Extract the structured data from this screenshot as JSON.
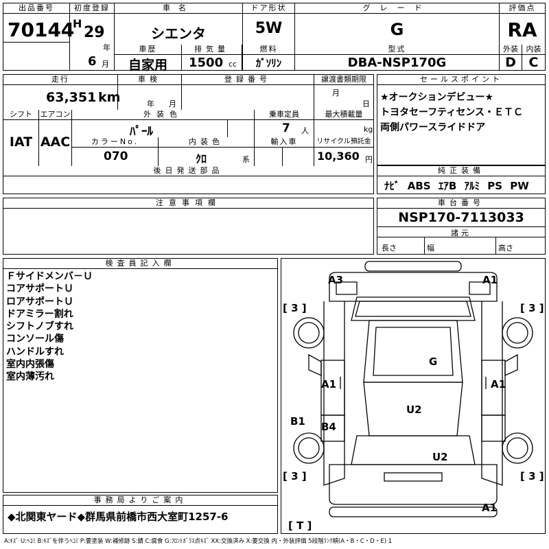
{
  "header": {
    "lot_number_label": "出品番号",
    "lot_number": "70144",
    "first_reg_label": "初度登録",
    "first_reg_era": "H",
    "first_reg_year": "29",
    "year_unit": "年",
    "first_reg_month": "6",
    "month_unit": "月",
    "car_name_label": "車名",
    "car_name": "シエンタ",
    "door_label": "ドア形状",
    "door": "5W",
    "grade_label": "グレード",
    "grade": "G",
    "score_label": "評価点",
    "score": "RA",
    "history_label": "車歴",
    "history": "自家用",
    "displacement_label": "排気量",
    "displacement": "1500",
    "displacement_unit": "cc",
    "fuel_label": "燃料",
    "fuel": "ｶﾞｿﾘﾝ",
    "model_label": "型式",
    "model": "DBA-NSP170G",
    "exterior_label": "外装",
    "exterior": "D",
    "interior_label": "内装",
    "interior": "C"
  },
  "mid": {
    "mileage_label": "走行",
    "mileage": "63,351",
    "mileage_unit": "km",
    "inspection_label": "車検",
    "inspection_year_unit": "年",
    "inspection_month_unit": "月",
    "registration_label": "登録番号",
    "transfer_label": "譲渡書類期限",
    "transfer_month_unit": "月",
    "transfer_day_unit": "日",
    "shift_label": "シフト",
    "shift": "IAT",
    "ac_label": "エアコン",
    "ac": "AAC",
    "color_label": "外装色",
    "color": "ﾊﾟｰﾙ",
    "capacity_label": "乗車定員",
    "capacity": "7",
    "capacity_unit": "人",
    "maxload_label": "最大積載量",
    "maxload_unit": "kg",
    "color_no_label": "カラーNo.",
    "color_no": "070",
    "int_color_label": "内装色",
    "int_color": "ｸﾛ",
    "int_color_unit": "系",
    "import_label": "輸入車",
    "recycle_label": "リサイクル預託金",
    "recycle": "10,360",
    "recycle_unit": "円",
    "later_parts_label": "後日発送部品"
  },
  "selling_points": {
    "label": "セールスポイント",
    "lines": [
      "★オークションデビュー★",
      "トヨタセーフティセンス・ＥＴＣ",
      "両側パワースライドドア"
    ]
  },
  "equipment": {
    "label": "純正装備",
    "items": [
      "ﾅﾋﾞ",
      "ABS",
      "ｴｱB",
      "ｱﾙﾐ",
      "PS",
      "PW"
    ]
  },
  "notes": {
    "label": "注意事項欄"
  },
  "chassis": {
    "label": "車台番号",
    "number": "NSP170-7113033",
    "specs_label": "諸元",
    "length_label": "長さ",
    "width_label": "幅",
    "height_label": "高さ"
  },
  "inspector": {
    "label": "検査員記入欄",
    "remarks": [
      "Ｆサイドメンバ－Ｕ",
      "コアサポートＵ",
      "ロアサポートＵ",
      "ドアミラー割れ",
      "シフトノブすれ",
      "コンソール傷",
      "ハンドルすれ",
      "室内内張傷",
      "室内薄汚れ"
    ]
  },
  "diagram": {
    "marks": {
      "a3": "A3",
      "a1_top": "A1",
      "g": "G",
      "a1_left": "A1",
      "a1_right": "A1",
      "b1": "B1",
      "b4": "B4",
      "u2_mid": "U2",
      "u2_rear": "U2",
      "a1_bottom": "A1"
    },
    "tires": {
      "fl": "[ 3 ]",
      "fr": "[ 3 ]",
      "rl": "[ 3 ]",
      "rr": "[ 3 ]",
      "spare": "[ T ]"
    }
  },
  "office": {
    "label": "事務局よりご案内",
    "message": "◆北関東ヤード◆群馬県前橋市西大室町1257-6"
  },
  "legend": "A:ｷｽﾞ U:ﾍｺﾐ B:ｷｽﾞを伴うﾍｺﾐ P:要塗装 W:補修跡 S:錆 C:腐食 G:ﾌﾛﾝﾄｶﾞﾗｽ点ｷｽﾞ XX:交換済み X:要交換 内・外装評価 5段階ﾗﾝｸ順(A・B・C・D・E) 1"
}
